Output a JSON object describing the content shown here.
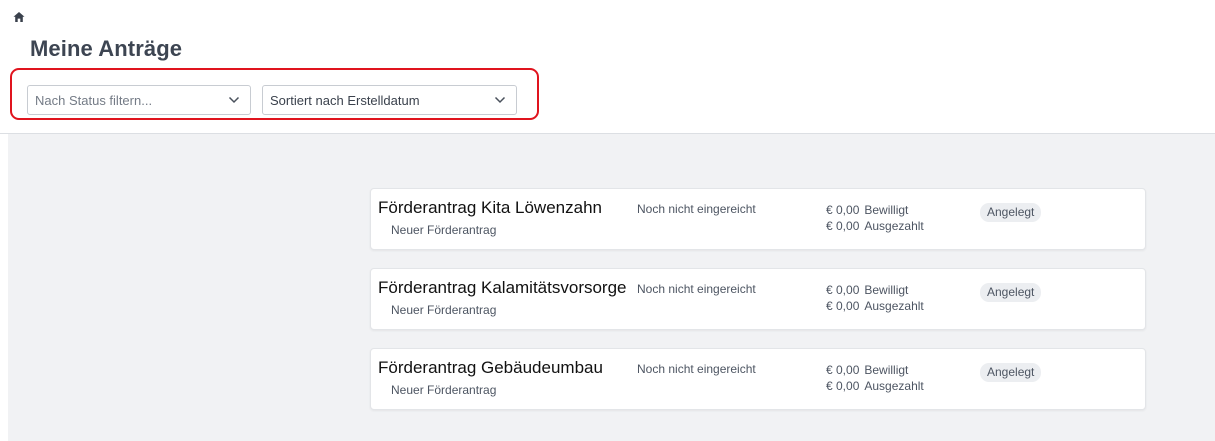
{
  "header": {
    "home_icon": "home-icon",
    "title": "Meine Anträge"
  },
  "filters": {
    "status_placeholder": "Nach Status filtern...",
    "sort_value": "Sortiert nach Erstelldatum",
    "highlight_color": "#e0141e"
  },
  "applications": [
    {
      "title": "Förderantrag Kita Löwenzahn",
      "subtitle": "Neuer Förderantrag",
      "submit_status": "Noch nicht eingereicht",
      "approved_amount": "€ 0,00",
      "approved_label": "Bewilligt",
      "paid_amount": "€ 0,00",
      "paid_label": "Ausgezahlt",
      "badge": "Angelegt"
    },
    {
      "title": "Förderantrag Kalamitätsvorsorge",
      "subtitle": "Neuer Förderantrag",
      "submit_status": "Noch nicht eingereicht",
      "approved_amount": "€ 0,00",
      "approved_label": "Bewilligt",
      "paid_amount": "€ 0,00",
      "paid_label": "Ausgezahlt",
      "badge": "Angelegt"
    },
    {
      "title": "Förderantrag Gebäudeumbau",
      "subtitle": "Neuer Förderantrag",
      "submit_status": "Noch nicht eingereicht",
      "approved_amount": "€ 0,00",
      "approved_label": "Bewilligt",
      "paid_amount": "€ 0,00",
      "paid_label": "Ausgezahlt",
      "badge": "Angelegt"
    }
  ]
}
